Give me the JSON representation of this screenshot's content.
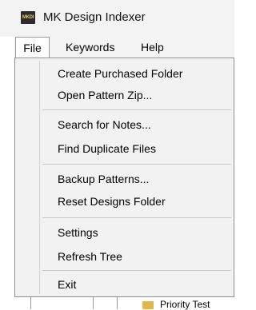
{
  "window": {
    "title": "MK Design Indexer",
    "icon_text": "MKDI",
    "icon": "app-logo-icon"
  },
  "menubar": {
    "items": [
      {
        "label": "File"
      },
      {
        "label": "Keywords"
      },
      {
        "label": "Help"
      }
    ]
  },
  "file_menu": {
    "items": [
      {
        "label": "Create Purchased Folder"
      },
      {
        "label": "Open Pattern Zip..."
      },
      {
        "label": "Search for Notes..."
      },
      {
        "label": "Find Duplicate Files"
      },
      {
        "label": "Backup Patterns..."
      },
      {
        "label": "Reset Designs Folder"
      },
      {
        "label": "Settings"
      },
      {
        "label": "Refresh Tree"
      },
      {
        "label": "Exit"
      }
    ]
  },
  "background": {
    "tree_item_text": "Priority Test",
    "folder_icon": "folder-icon"
  },
  "colors": {
    "titlebar": "#f3f3f3",
    "menu_bg": "#f2f2f2",
    "folder": "#e3b64a"
  }
}
